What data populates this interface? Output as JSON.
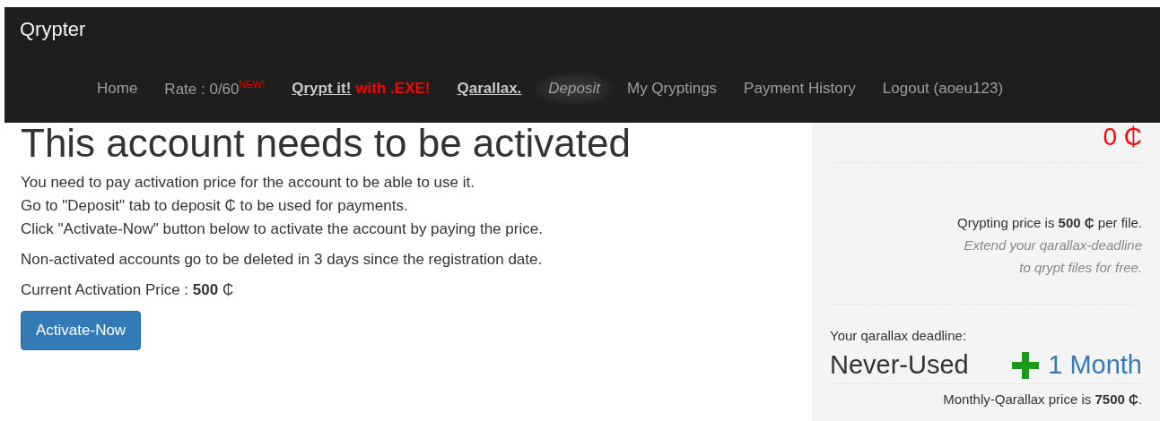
{
  "navbar": {
    "brand": "Qrypter",
    "items": [
      {
        "kind": "plain",
        "label": "Home",
        "selected": false
      },
      {
        "kind": "badge",
        "label": "Rate : 0/60",
        "badge": "NEW!",
        "selected": false
      },
      {
        "kind": "strong",
        "label": "Qrypt it!",
        "suffix": "with .EXE!",
        "selected": false
      },
      {
        "kind": "strong",
        "label": "Qarallax.",
        "selected": false
      },
      {
        "kind": "plain",
        "label": "Deposit",
        "selected": true
      },
      {
        "kind": "plain",
        "label": "My Qryptings",
        "selected": false
      },
      {
        "kind": "plain",
        "label": "Payment History",
        "selected": false
      },
      {
        "kind": "plain",
        "label": "Logout (aoeu123)",
        "selected": false
      }
    ]
  },
  "main": {
    "heading": "This account needs to be activated",
    "paragraphs": [
      [
        "You need to pay activation price for the account to be able to use it.",
        "Go to \"Deposit\" tab to deposit ₵ to be used for payments.",
        "Click \"Activate-Now\" button below to activate the account by paying the price."
      ],
      [
        "Non-activated accounts go to be deleted in 3 days since the registration date."
      ],
      [
        "Current Activation Price : **500** ₵"
      ]
    ],
    "button": "Activate-Now"
  },
  "sidebar": {
    "balance": "0 ₵",
    "price_note": "Qrypting price is **500 ₵** per file.",
    "hint_lines": [
      "Extend your qarallax-deadline",
      "to qrypt files for free."
    ],
    "deadline_label": "Your qarallax deadline:",
    "deadline_value": "Never-Used",
    "extend_link": "1 Month",
    "monthly_note": "Monthly-Qarallax price is **7500 ₵**."
  }
}
